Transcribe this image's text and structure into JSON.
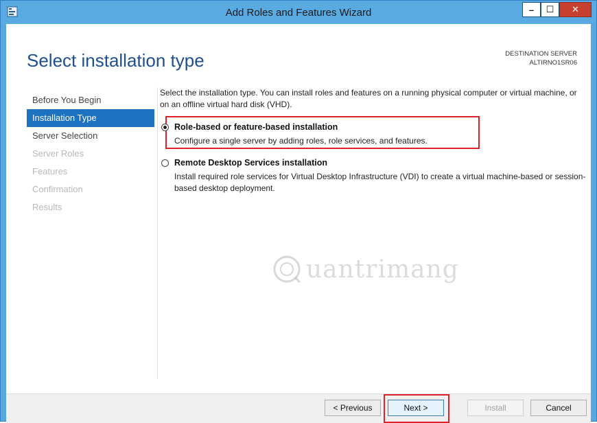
{
  "window": {
    "title": "Add Roles and Features Wizard",
    "controls": {
      "minimize": "–",
      "maximize": "☐",
      "close": "✕"
    }
  },
  "header": {
    "page_title": "Select installation type",
    "destination_label": "DESTINATION SERVER",
    "destination_value": "ALTIRNO1SR06"
  },
  "nav": {
    "items": [
      {
        "label": "Before You Begin",
        "state": "normal"
      },
      {
        "label": "Installation Type",
        "state": "active"
      },
      {
        "label": "Server Selection",
        "state": "normal"
      },
      {
        "label": "Server Roles",
        "state": "disabled"
      },
      {
        "label": "Features",
        "state": "disabled"
      },
      {
        "label": "Confirmation",
        "state": "disabled"
      },
      {
        "label": "Results",
        "state": "disabled"
      }
    ]
  },
  "content": {
    "intro": "Select the installation type. You can install roles and features on a running physical computer or virtual machine, or on an offline virtual hard disk (VHD).",
    "options": [
      {
        "title": "Role-based or feature-based installation",
        "description": "Configure a single server by adding roles, role services, and features.",
        "selected": true
      },
      {
        "title": "Remote Desktop Services installation",
        "description": "Install required role services for Virtual Desktop Infrastructure (VDI) to create a virtual machine-based or session-based desktop deployment.",
        "selected": false
      }
    ]
  },
  "watermark": {
    "text": "uantrimang"
  },
  "footer": {
    "previous": "< Previous",
    "next": "Next >",
    "install": "Install",
    "cancel": "Cancel"
  },
  "colors": {
    "title_bar": "#5aaae2",
    "accent": "#1e72c2",
    "highlight": "#e0212a",
    "page_title": "#1f4f8f"
  }
}
